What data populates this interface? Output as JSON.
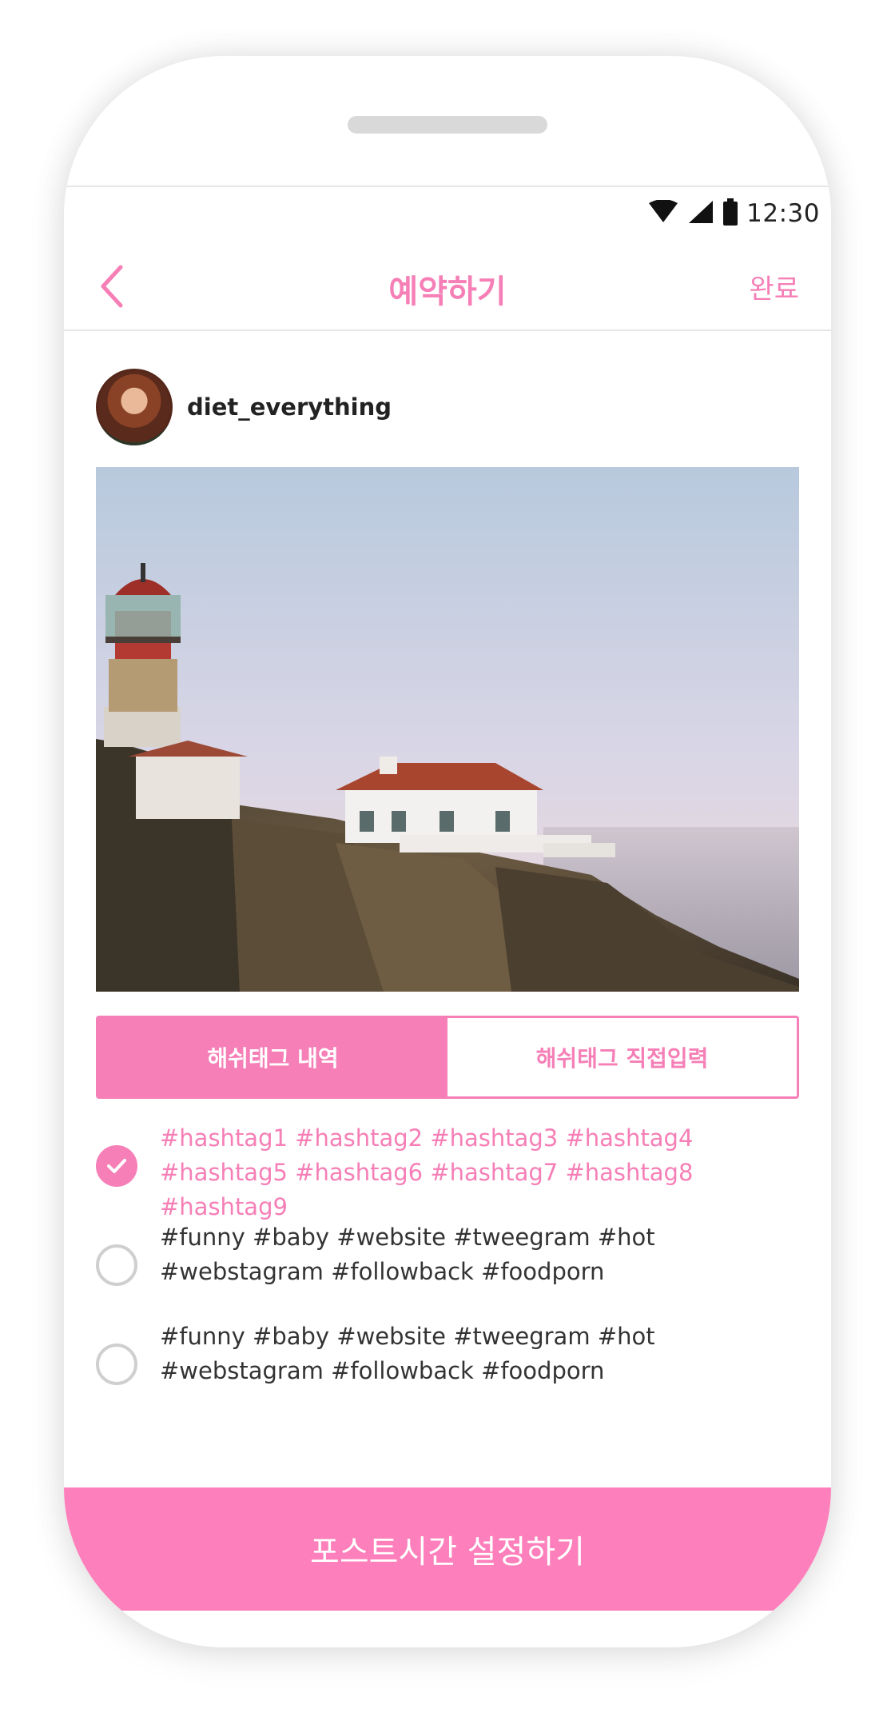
{
  "status": {
    "time": "12:30",
    "icons": [
      "wifi-icon",
      "signal-icon",
      "battery-icon"
    ]
  },
  "header": {
    "back_icon": "chevron-left-icon",
    "title": "예약하기",
    "done_label": "완료"
  },
  "post": {
    "username": "diet_everything",
    "photo_description_icon": "lighthouse-photo"
  },
  "tabs": [
    {
      "label": "해쉬태그 내역",
      "active": true
    },
    {
      "label": "해쉬태그 직접입력",
      "active": false
    }
  ],
  "hashtag_sets": [
    {
      "text": "#hashtag1 #hashtag2 #hashtag3 #hashtag4 #hashtag5 #hashtag6 #hashtag7 #hashtag8 #hashtag9",
      "selected": true
    },
    {
      "text": "#funny #baby #website #tweegram #hot #webstagram #followback #foodporn",
      "selected": false
    },
    {
      "text": "#funny #baby #website #tweegram #hot #webstagram #followback #foodporn",
      "selected": false
    }
  ],
  "cta_label": "포스트시간 설정하기",
  "colors": {
    "accent": "#f57fb6",
    "cta": "#fd7fbb"
  }
}
